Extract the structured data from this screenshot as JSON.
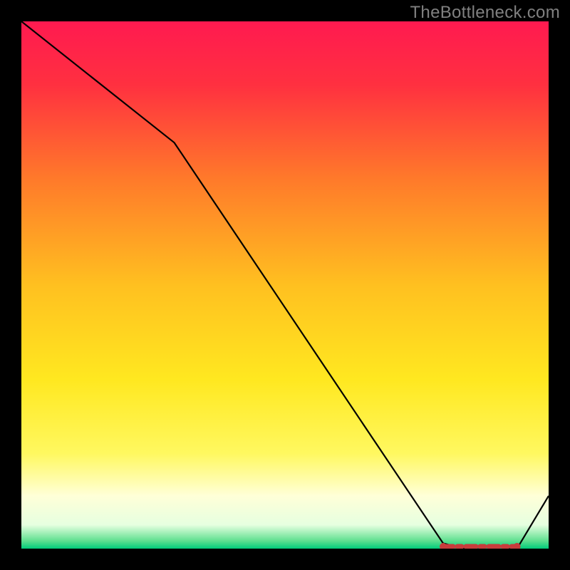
{
  "attribution": "TheBottleneck.com",
  "chart_data": {
    "type": "line",
    "xlabel": "",
    "ylabel": "",
    "xlim": [
      0,
      100
    ],
    "ylim": [
      0,
      100
    ],
    "series": [
      {
        "name": "curve",
        "x": [
          0,
          29,
          80,
          84,
          90,
          94,
          100
        ],
        "values": [
          100,
          77,
          1,
          0,
          0.5,
          0,
          10
        ]
      }
    ],
    "background_gradient": {
      "stops": [
        {
          "pos": 0.0,
          "color": "#ff1a50"
        },
        {
          "pos": 0.12,
          "color": "#ff3040"
        },
        {
          "pos": 0.3,
          "color": "#ff7a2a"
        },
        {
          "pos": 0.5,
          "color": "#ffc020"
        },
        {
          "pos": 0.68,
          "color": "#ffe820"
        },
        {
          "pos": 0.82,
          "color": "#fff860"
        },
        {
          "pos": 0.9,
          "color": "#ffffd8"
        },
        {
          "pos": 0.955,
          "color": "#e6ffe0"
        },
        {
          "pos": 0.985,
          "color": "#60e090"
        },
        {
          "pos": 1.0,
          "color": "#00cc7a"
        }
      ]
    },
    "sweet_spot_marker": {
      "x_range": [
        80,
        94
      ],
      "y": 0,
      "color": "#c83c3c"
    }
  }
}
